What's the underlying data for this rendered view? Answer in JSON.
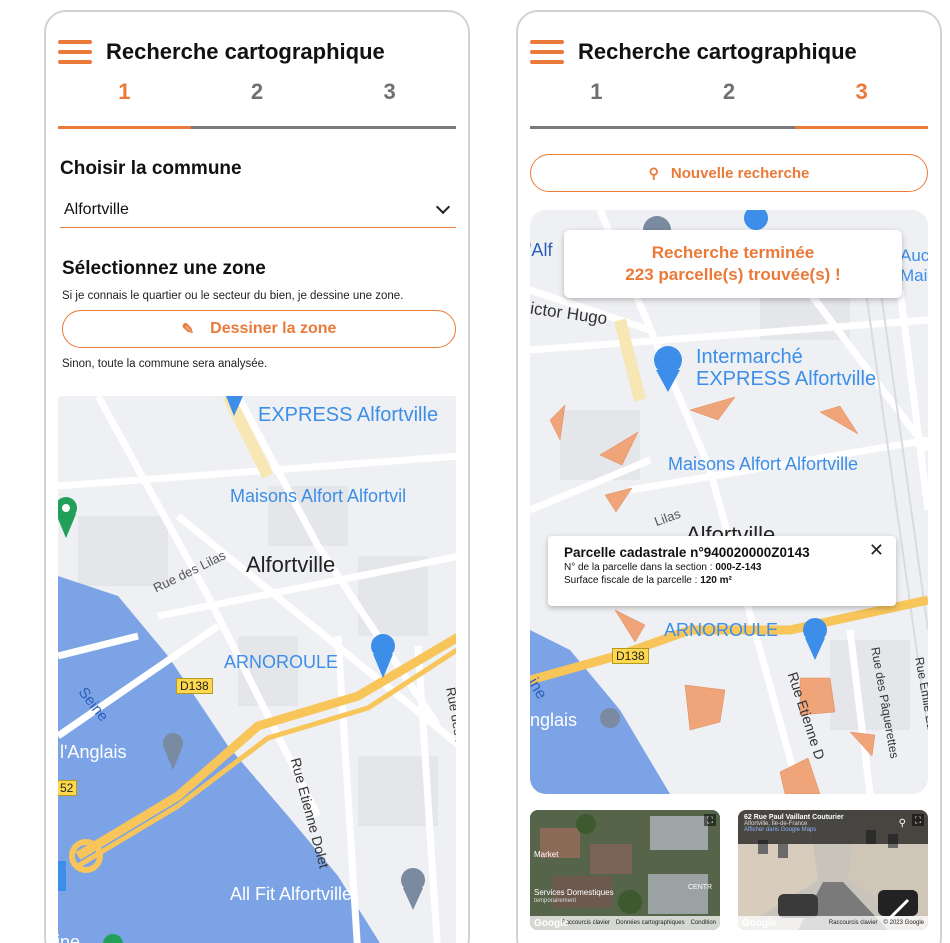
{
  "header": {
    "title": "Recherche cartographique"
  },
  "steps": [
    "1",
    "2",
    "3"
  ],
  "left_screen": {
    "active_step": 1,
    "commune_label": "Choisir la commune",
    "commune_value": "Alfortville",
    "zone_title": "Sélectionnez une zone",
    "zone_description": "Si je connais le quartier ou le secteur du bien, je dessine une zone.",
    "draw_button": "Dessiner la zone",
    "zone_note": "Sinon, toute la commune sera analysée.",
    "map_labels": {
      "express": "EXPRESS Alfortville",
      "maisons": "Maisons Alfort Alfortvil",
      "town": "Alfortville",
      "rue_lilas": "Rue des Lilas",
      "arnoroule": "ARNOROULE",
      "d138": "D138",
      "rue_dolet": "Rue Etienne Dolet",
      "rue_paquerettes": "Rue des Pâquer",
      "seine": "Seine",
      "anglais": "l'Anglais",
      "d152": "52",
      "allfit": "All Fit Alfortville",
      "bottom": "ine"
    }
  },
  "right_screen": {
    "active_step": 3,
    "new_search_button": "Nouvelle recherche",
    "banner": {
      "line1": "Recherche terminée",
      "line2": "223 parcelle(s) trouvée(s) !"
    },
    "popup": {
      "title": "Parcelle cadastrale n°940020000Z0143",
      "line1_label": "N° de la parcelle dans la section :",
      "line1_value": "000-Z-143",
      "line2_label": "Surface fiscale de la parcelle :",
      "line2_value": "120 m²"
    },
    "map_labels": {
      "alf": "'Alf",
      "auc": "Auc",
      "mais": "Mais",
      "victor_hugo": "ictor Hugo",
      "intermarche1": "Intermarché",
      "intermarche2": "EXPRESS Alfortville",
      "maisons": "Maisons Alfort Alfortville",
      "lilas": "Lilas",
      "town": "Alfortville",
      "arnoroule": "ARNOROULE",
      "d138": "D138",
      "ine": "ine",
      "anglais": "nglais",
      "rue_dolet": "Rue Etienne D",
      "rue_paquerettes": "Rue des Pâquerettes",
      "rue_emile": "Rue Emile Eud"
    },
    "thumb_aerial": {
      "label_market": "Market",
      "label_services": "Services Domestiques",
      "label_services2": "temporairement",
      "label_centr": "CENTR",
      "google": "Google",
      "footer": [
        "Raccourcis clavier",
        "Données cartographiques",
        "Condition"
      ]
    },
    "thumb_street": {
      "title": "62 Rue Paul Vaillant Couturier",
      "subtitle": "Alfortville, Île-de-France",
      "link": "Afficher dans Google Maps",
      "google": "Google",
      "footer": [
        "Raccourcis clavier",
        "© 2023 Google"
      ]
    }
  },
  "colors": {
    "accent": "#ea7a3a",
    "parcel": "#f0a47a",
    "road_major": "#f7c55a",
    "water": "#7ba3e6",
    "poi_blue": "#3c8ee8"
  },
  "icons": [
    "hamburger-icon",
    "chevron-down-icon",
    "pencil-icon",
    "search-icon",
    "close-icon",
    "location-pin-icon",
    "cart-pin-icon",
    "bag-pin-icon",
    "fullscreen-icon"
  ]
}
